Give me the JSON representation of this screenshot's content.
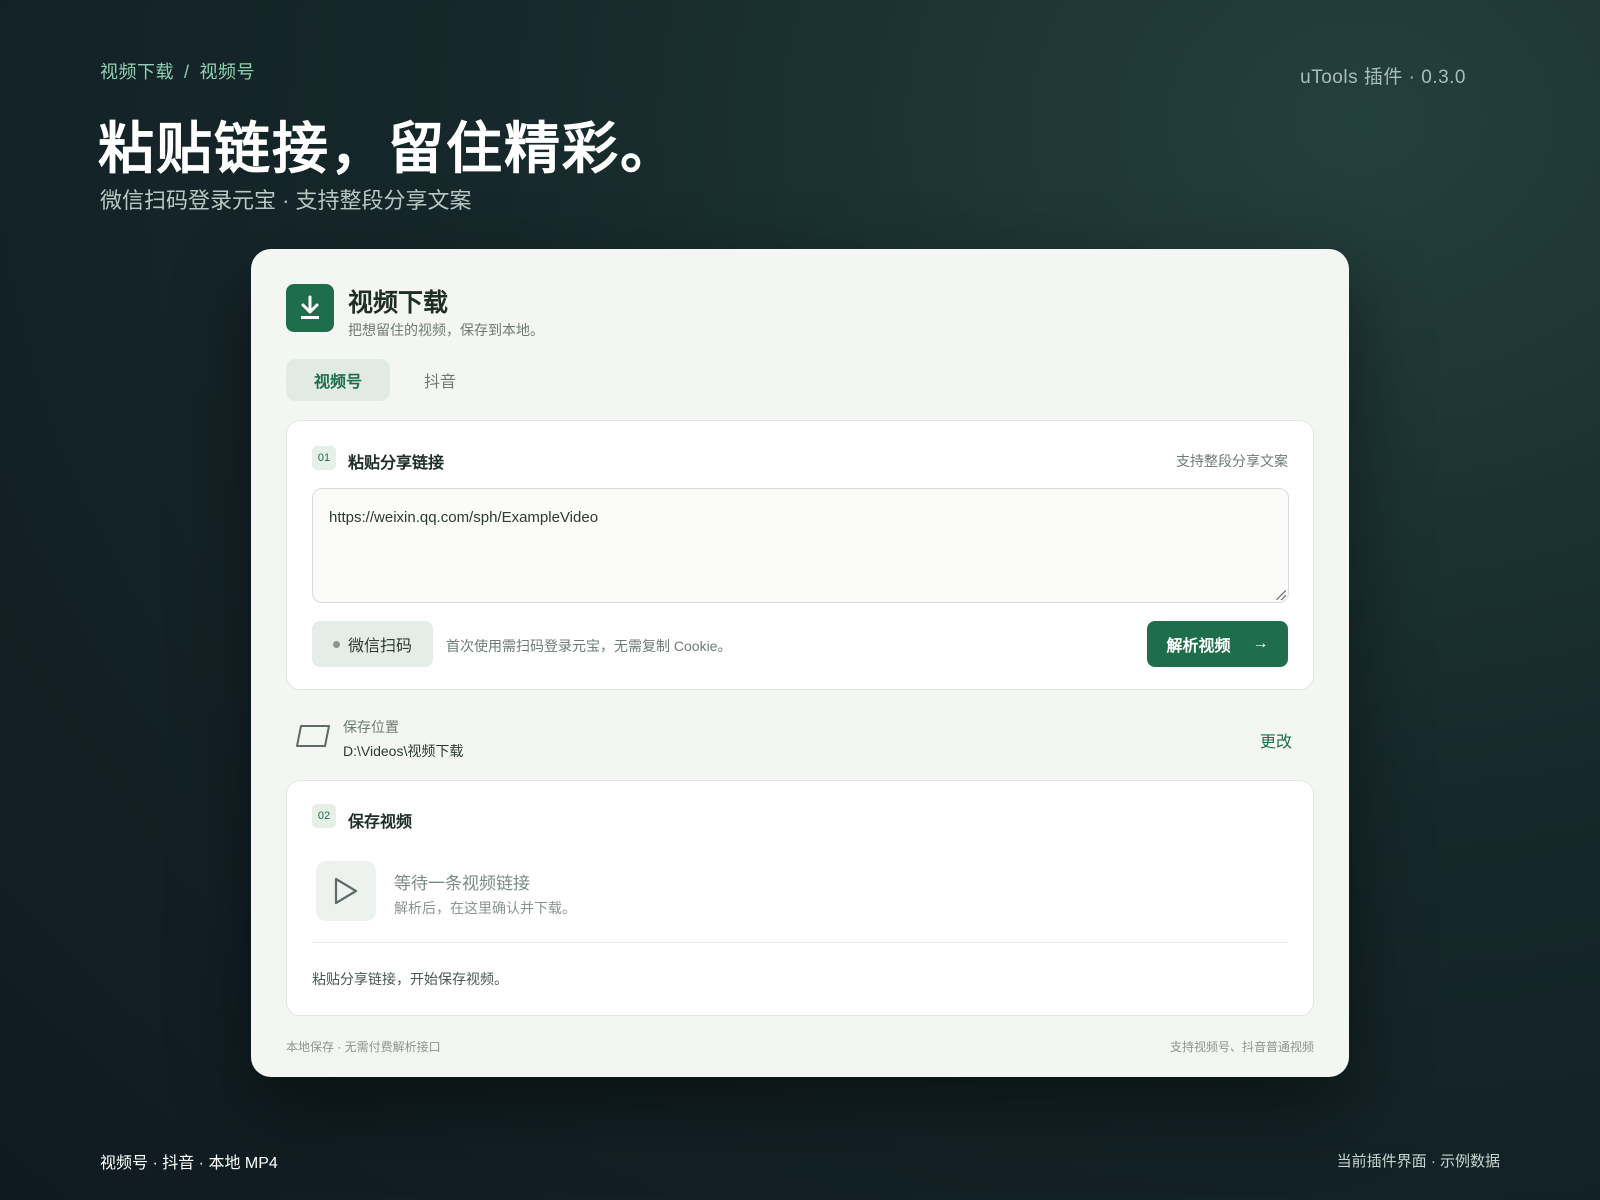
{
  "header": {
    "breadcrumb": [
      "视频下载",
      "视频号"
    ],
    "breadcrumb_sep": "/",
    "version": "uTools 插件 · 0.3.0",
    "title": "粘贴链接，留住精彩。",
    "subtitle": "微信扫码登录元宝 · 支持整段分享文案"
  },
  "app": {
    "icon": "download-icon",
    "title": "视频下载",
    "subtitle": "把想留住的视频，保存到本地。"
  },
  "tabs": [
    {
      "label": "视频号",
      "active": true
    },
    {
      "label": "抖音",
      "active": false
    }
  ],
  "step1": {
    "number": "01",
    "title": "粘贴分享链接",
    "hint": "支持整段分享文案",
    "url_value": "https://weixin.qq.com/sph/ExampleVideo",
    "scan_button": "微信扫码",
    "scan_note": "首次使用需扫码登录元宝，无需复制 Cookie。",
    "parse_button": "解析视频",
    "parse_arrow": "→"
  },
  "save_location": {
    "icon": "folder-icon",
    "label": "保存位置",
    "path": "D:\\Videos\\视频下载",
    "change": "更改"
  },
  "step2": {
    "number": "02",
    "title": "保存视频",
    "icon": "play-icon",
    "waiting_title": "等待一条视频链接",
    "waiting_sub": "解析后，在这里确认并下载。",
    "footer_text": "粘贴分享链接，开始保存视频。"
  },
  "card_footer": {
    "left": "本地保存 · 无需付费解析接口",
    "right": "支持视频号、抖音普通视频"
  },
  "page_footer": {
    "left": "视频号 · 抖音 · 本地 MP4",
    "right": "当前插件界面 · 示例数据"
  },
  "colors": {
    "accent": "#1e6e4c",
    "background": "#16282b",
    "card": "#f4f6f3"
  }
}
